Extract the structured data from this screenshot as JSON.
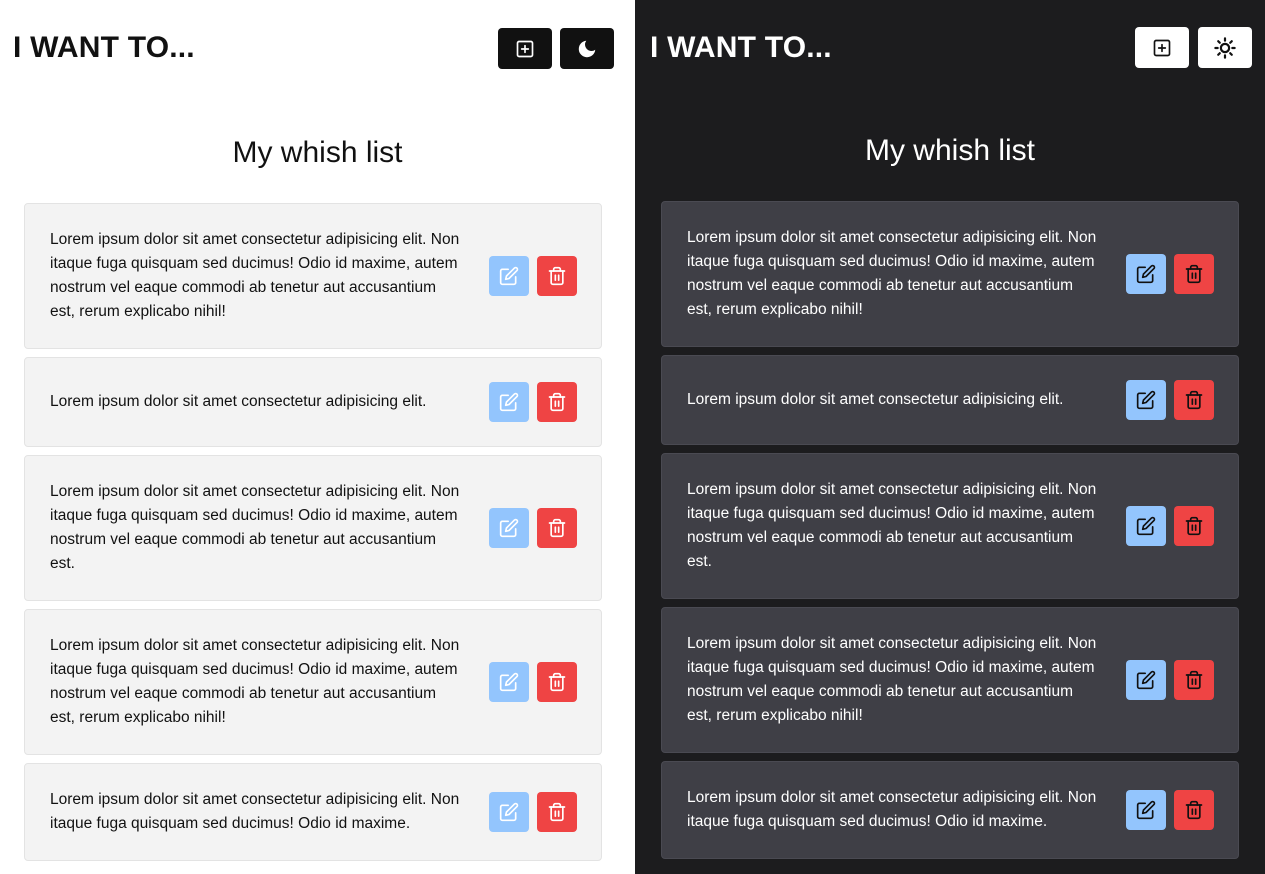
{
  "light": {
    "brand": "I WANT TO...",
    "add_icon": "plus-square-icon",
    "mode_icon": "moon-icon",
    "list_title": "My whish list",
    "items": [
      "Lorem ipsum dolor sit amet consectetur adipisicing elit. Non itaque fuga quisquam sed ducimus! Odio id maxime, autem nostrum vel eaque commodi ab tenetur aut accusantium est, rerum explicabo nihil!",
      "Lorem ipsum dolor sit amet consectetur adipisicing elit.",
      "Lorem ipsum dolor sit amet consectetur adipisicing elit. Non itaque fuga quisquam sed ducimus! Odio id maxime, autem nostrum vel eaque commodi ab tenetur aut accusantium est.",
      "Lorem ipsum dolor sit amet consectetur adipisicing elit. Non itaque fuga quisquam sed ducimus! Odio id maxime, autem nostrum vel eaque commodi ab tenetur aut accusantium est, rerum explicabo nihil!",
      "Lorem ipsum dolor sit amet consectetur adipisicing elit. Non itaque fuga quisquam sed ducimus! Odio id maxime."
    ]
  },
  "dark": {
    "brand": "I WANT TO...",
    "add_icon": "plus-square-icon",
    "mode_icon": "sun-icon",
    "list_title": "My whish list",
    "items": [
      "Lorem ipsum dolor sit amet consectetur adipisicing elit. Non itaque fuga quisquam sed ducimus! Odio id maxime, autem nostrum vel eaque commodi ab tenetur aut accusantium est, rerum explicabo nihil!",
      "Lorem ipsum dolor sit amet consectetur adipisicing elit.",
      "Lorem ipsum dolor sit amet consectetur adipisicing elit. Non itaque fuga quisquam sed ducimus! Odio id maxime, autem nostrum vel eaque commodi ab tenetur aut accusantium est.",
      "Lorem ipsum dolor sit amet consectetur adipisicing elit. Non itaque fuga quisquam sed ducimus! Odio id maxime, autem nostrum vel eaque commodi ab tenetur aut accusantium est, rerum explicabo nihil!",
      "Lorem ipsum dolor sit amet consectetur adipisicing elit. Non itaque fuga quisquam sed ducimus! Odio id maxime."
    ]
  },
  "colors": {
    "light_bg": "#ffffff",
    "dark_bg": "#1c1c1e",
    "card_light": "#f3f3f3",
    "card_dark": "#3f3f46",
    "edit_button": "#93c5fd",
    "delete_button": "#ef4444"
  },
  "item_icons": {
    "edit": "edit-icon",
    "delete": "trash-icon"
  }
}
